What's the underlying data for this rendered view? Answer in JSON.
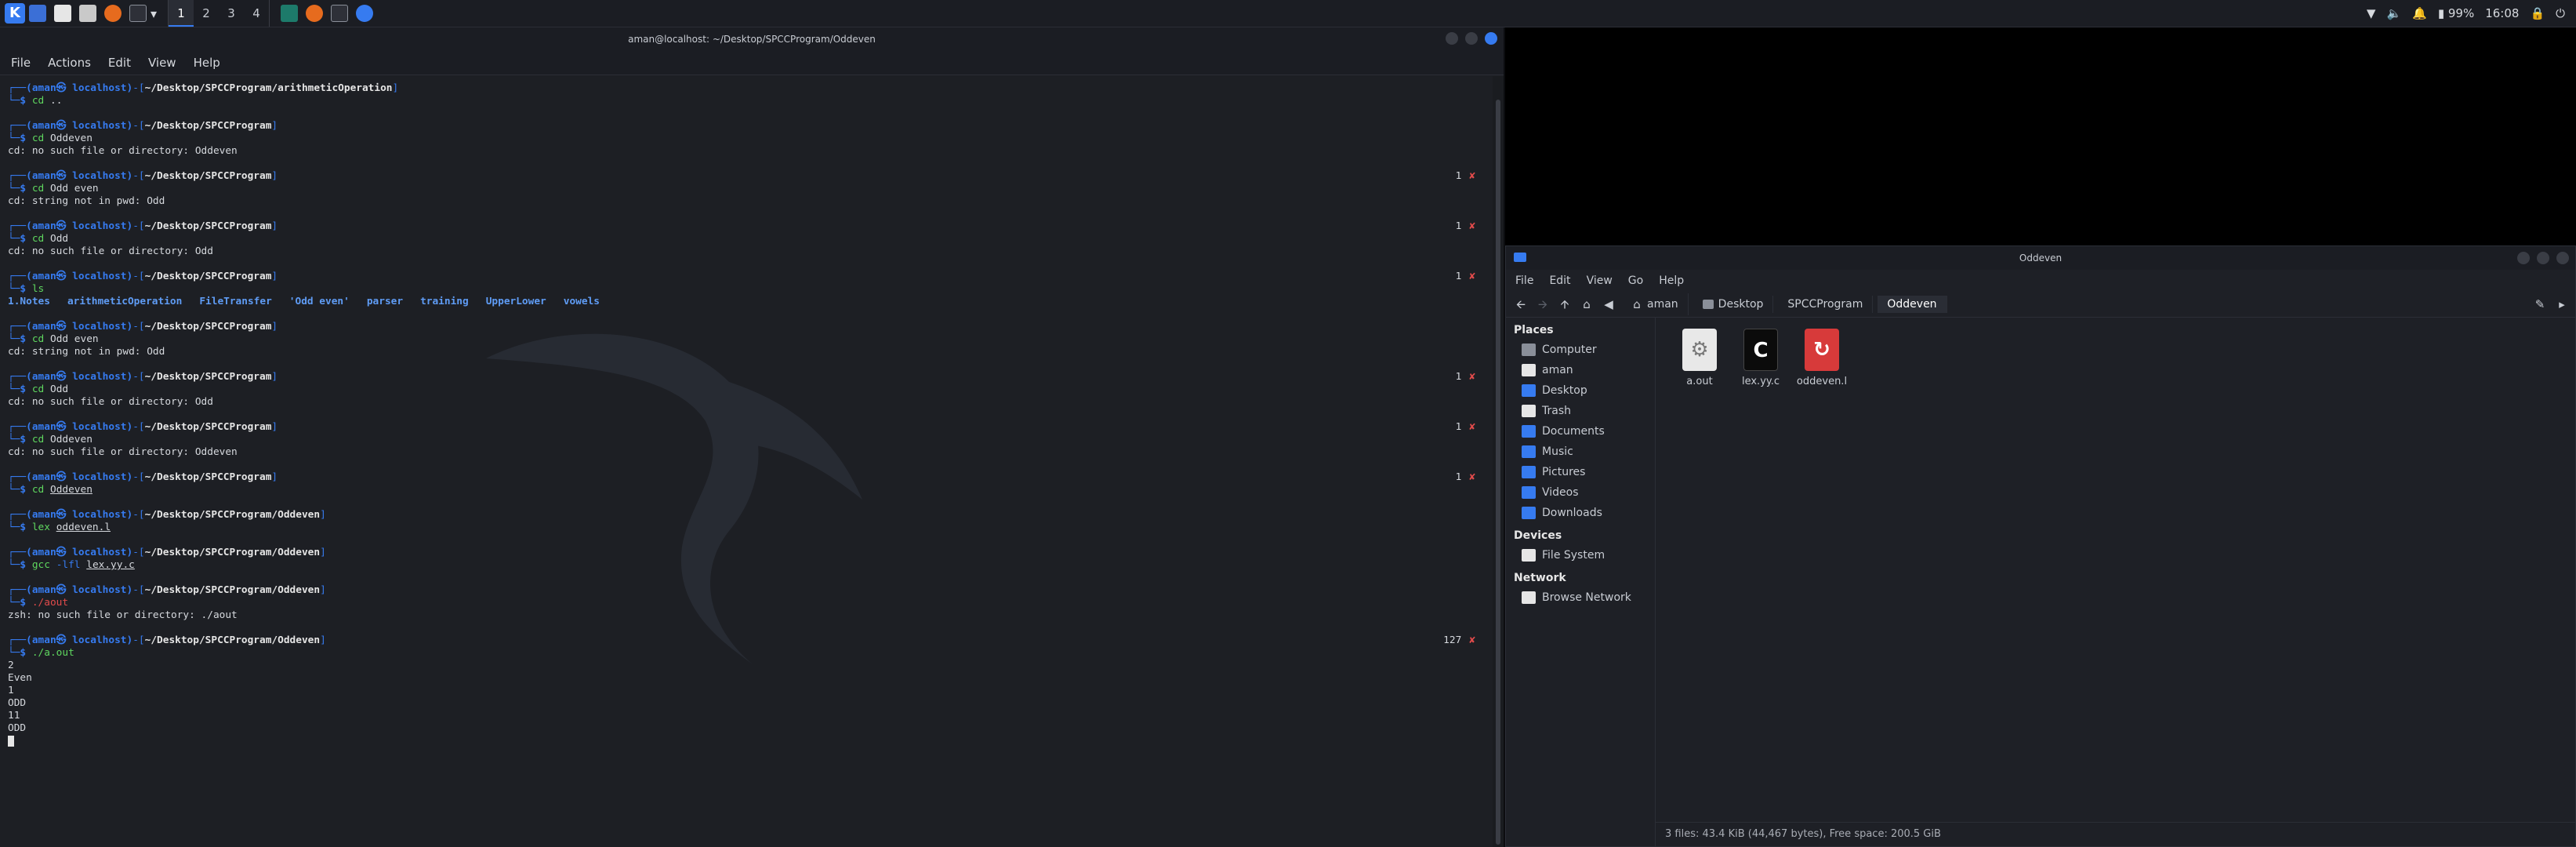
{
  "panel": {
    "workspaces": [
      "1",
      "2",
      "3",
      "4"
    ],
    "active_workspace": "1",
    "battery": "99%",
    "clock": "16:08"
  },
  "terminal": {
    "title": "aman@localhost: ~/Desktop/SPCCProgram/Oddeven",
    "menu": [
      "File",
      "Actions",
      "Edit",
      "View",
      "Help"
    ],
    "prompt_user": "(aman㉿ localhost)",
    "blocks": [
      {
        "path": "~/Desktop/SPCCProgram/arithmeticOperation",
        "cmd": "cd",
        "ok": true,
        "args": [
          {
            "t": "..",
            "u": false
          }
        ],
        "output": [],
        "status": ""
      },
      {
        "path": "~/Desktop/SPCCProgram",
        "cmd": "cd",
        "ok": true,
        "args": [
          {
            "t": "Oddeven",
            "u": false
          }
        ],
        "output": [
          "cd: no such file or directory: Oddeven"
        ],
        "status": ""
      },
      {
        "path": "~/Desktop/SPCCProgram",
        "cmd": "cd",
        "ok": true,
        "args": [
          {
            "t": "Odd even",
            "u": false
          }
        ],
        "output": [
          "cd: string not in pwd: Odd"
        ],
        "status": "1"
      },
      {
        "path": "~/Desktop/SPCCProgram",
        "cmd": "cd",
        "ok": true,
        "args": [
          {
            "t": "Odd",
            "u": false
          }
        ],
        "output": [
          "cd: no such file or directory: Odd"
        ],
        "status": "1"
      },
      {
        "path": "~/Desktop/SPCCProgram",
        "cmd": "ls",
        "ok": true,
        "args": [],
        "ls": [
          "1.Notes",
          "arithmeticOperation",
          "FileTransfer",
          "'Odd even'",
          "parser",
          "training",
          "UpperLower",
          "vowels"
        ],
        "output": [],
        "status": "1"
      },
      {
        "path": "~/Desktop/SPCCProgram",
        "cmd": "cd",
        "ok": true,
        "args": [
          {
            "t": "Odd even",
            "u": false
          }
        ],
        "output": [
          "cd: string not in pwd: Odd"
        ],
        "status": ""
      },
      {
        "path": "~/Desktop/SPCCProgram",
        "cmd": "cd",
        "ok": true,
        "args": [
          {
            "t": "Odd",
            "u": false
          }
        ],
        "output": [
          "cd: no such file or directory: Odd"
        ],
        "status": "1"
      },
      {
        "path": "~/Desktop/SPCCProgram",
        "cmd": "cd",
        "ok": true,
        "args": [
          {
            "t": "Oddeven",
            "u": false
          }
        ],
        "output": [
          "cd: no such file or directory: Oddeven"
        ],
        "status": "1"
      },
      {
        "path": "~/Desktop/SPCCProgram",
        "cmd": "cd",
        "ok": true,
        "args": [
          {
            "t": "Oddeven",
            "u": true
          }
        ],
        "output": [],
        "status": "1"
      },
      {
        "path": "~/Desktop/SPCCProgram/Oddeven",
        "cmd": "lex",
        "ok": true,
        "args": [
          {
            "t": "oddeven.l",
            "u": true
          }
        ],
        "output": [],
        "status": ""
      },
      {
        "path": "~/Desktop/SPCCProgram/Oddeven",
        "cmd": "gcc",
        "ok": true,
        "args": [
          {
            "t": "-lfl",
            "u": false,
            "opt": true
          },
          {
            "t": "lex.yy.c",
            "u": true
          }
        ],
        "output": [],
        "status": ""
      },
      {
        "path": "~/Desktop/SPCCProgram/Oddeven",
        "cmd": "./aout",
        "ok": false,
        "args": [],
        "output": [
          "zsh: no such file or directory: ./aout"
        ],
        "status": ""
      },
      {
        "path": "~/Desktop/SPCCProgram/Oddeven",
        "cmd": "./a.out",
        "ok": true,
        "args": [],
        "output": [
          "2",
          "Even",
          "1",
          "ODD",
          "11",
          "ODD"
        ],
        "status": "127"
      }
    ],
    "status_x": "✘"
  },
  "filemanager": {
    "title": "Oddeven",
    "menu": [
      "File",
      "Edit",
      "View",
      "Go",
      "Help"
    ],
    "breadcrumbs": [
      "aman",
      "Desktop",
      "SPCCProgram",
      "Oddeven"
    ],
    "places_header": "Places",
    "places": [
      {
        "label": "Computer",
        "icon": "computer-icon"
      },
      {
        "label": "aman",
        "icon": "home-folder-icon"
      },
      {
        "label": "Desktop",
        "icon": "desktop-folder-icon"
      },
      {
        "label": "Trash",
        "icon": "trash-icon"
      },
      {
        "label": "Documents",
        "icon": "documents-folder-icon"
      },
      {
        "label": "Music",
        "icon": "music-folder-icon"
      },
      {
        "label": "Pictures",
        "icon": "pictures-folder-icon"
      },
      {
        "label": "Videos",
        "icon": "videos-folder-icon"
      },
      {
        "label": "Downloads",
        "icon": "downloads-folder-icon"
      }
    ],
    "devices_header": "Devices",
    "devices": [
      {
        "label": "File System",
        "icon": "drive-icon"
      }
    ],
    "network_header": "Network",
    "network": [
      {
        "label": "Browse Network",
        "icon": "network-icon"
      }
    ],
    "files": [
      {
        "name": "a.out",
        "kind": "aout",
        "glyph": "⚙"
      },
      {
        "name": "lex.yy.c",
        "kind": "lex",
        "glyph": "C"
      },
      {
        "name": "oddeven.l",
        "kind": "l",
        "glyph": "↻"
      }
    ],
    "status": "3 files: 43.4 KiB (44,467 bytes), Free space: 200.5 GiB"
  }
}
